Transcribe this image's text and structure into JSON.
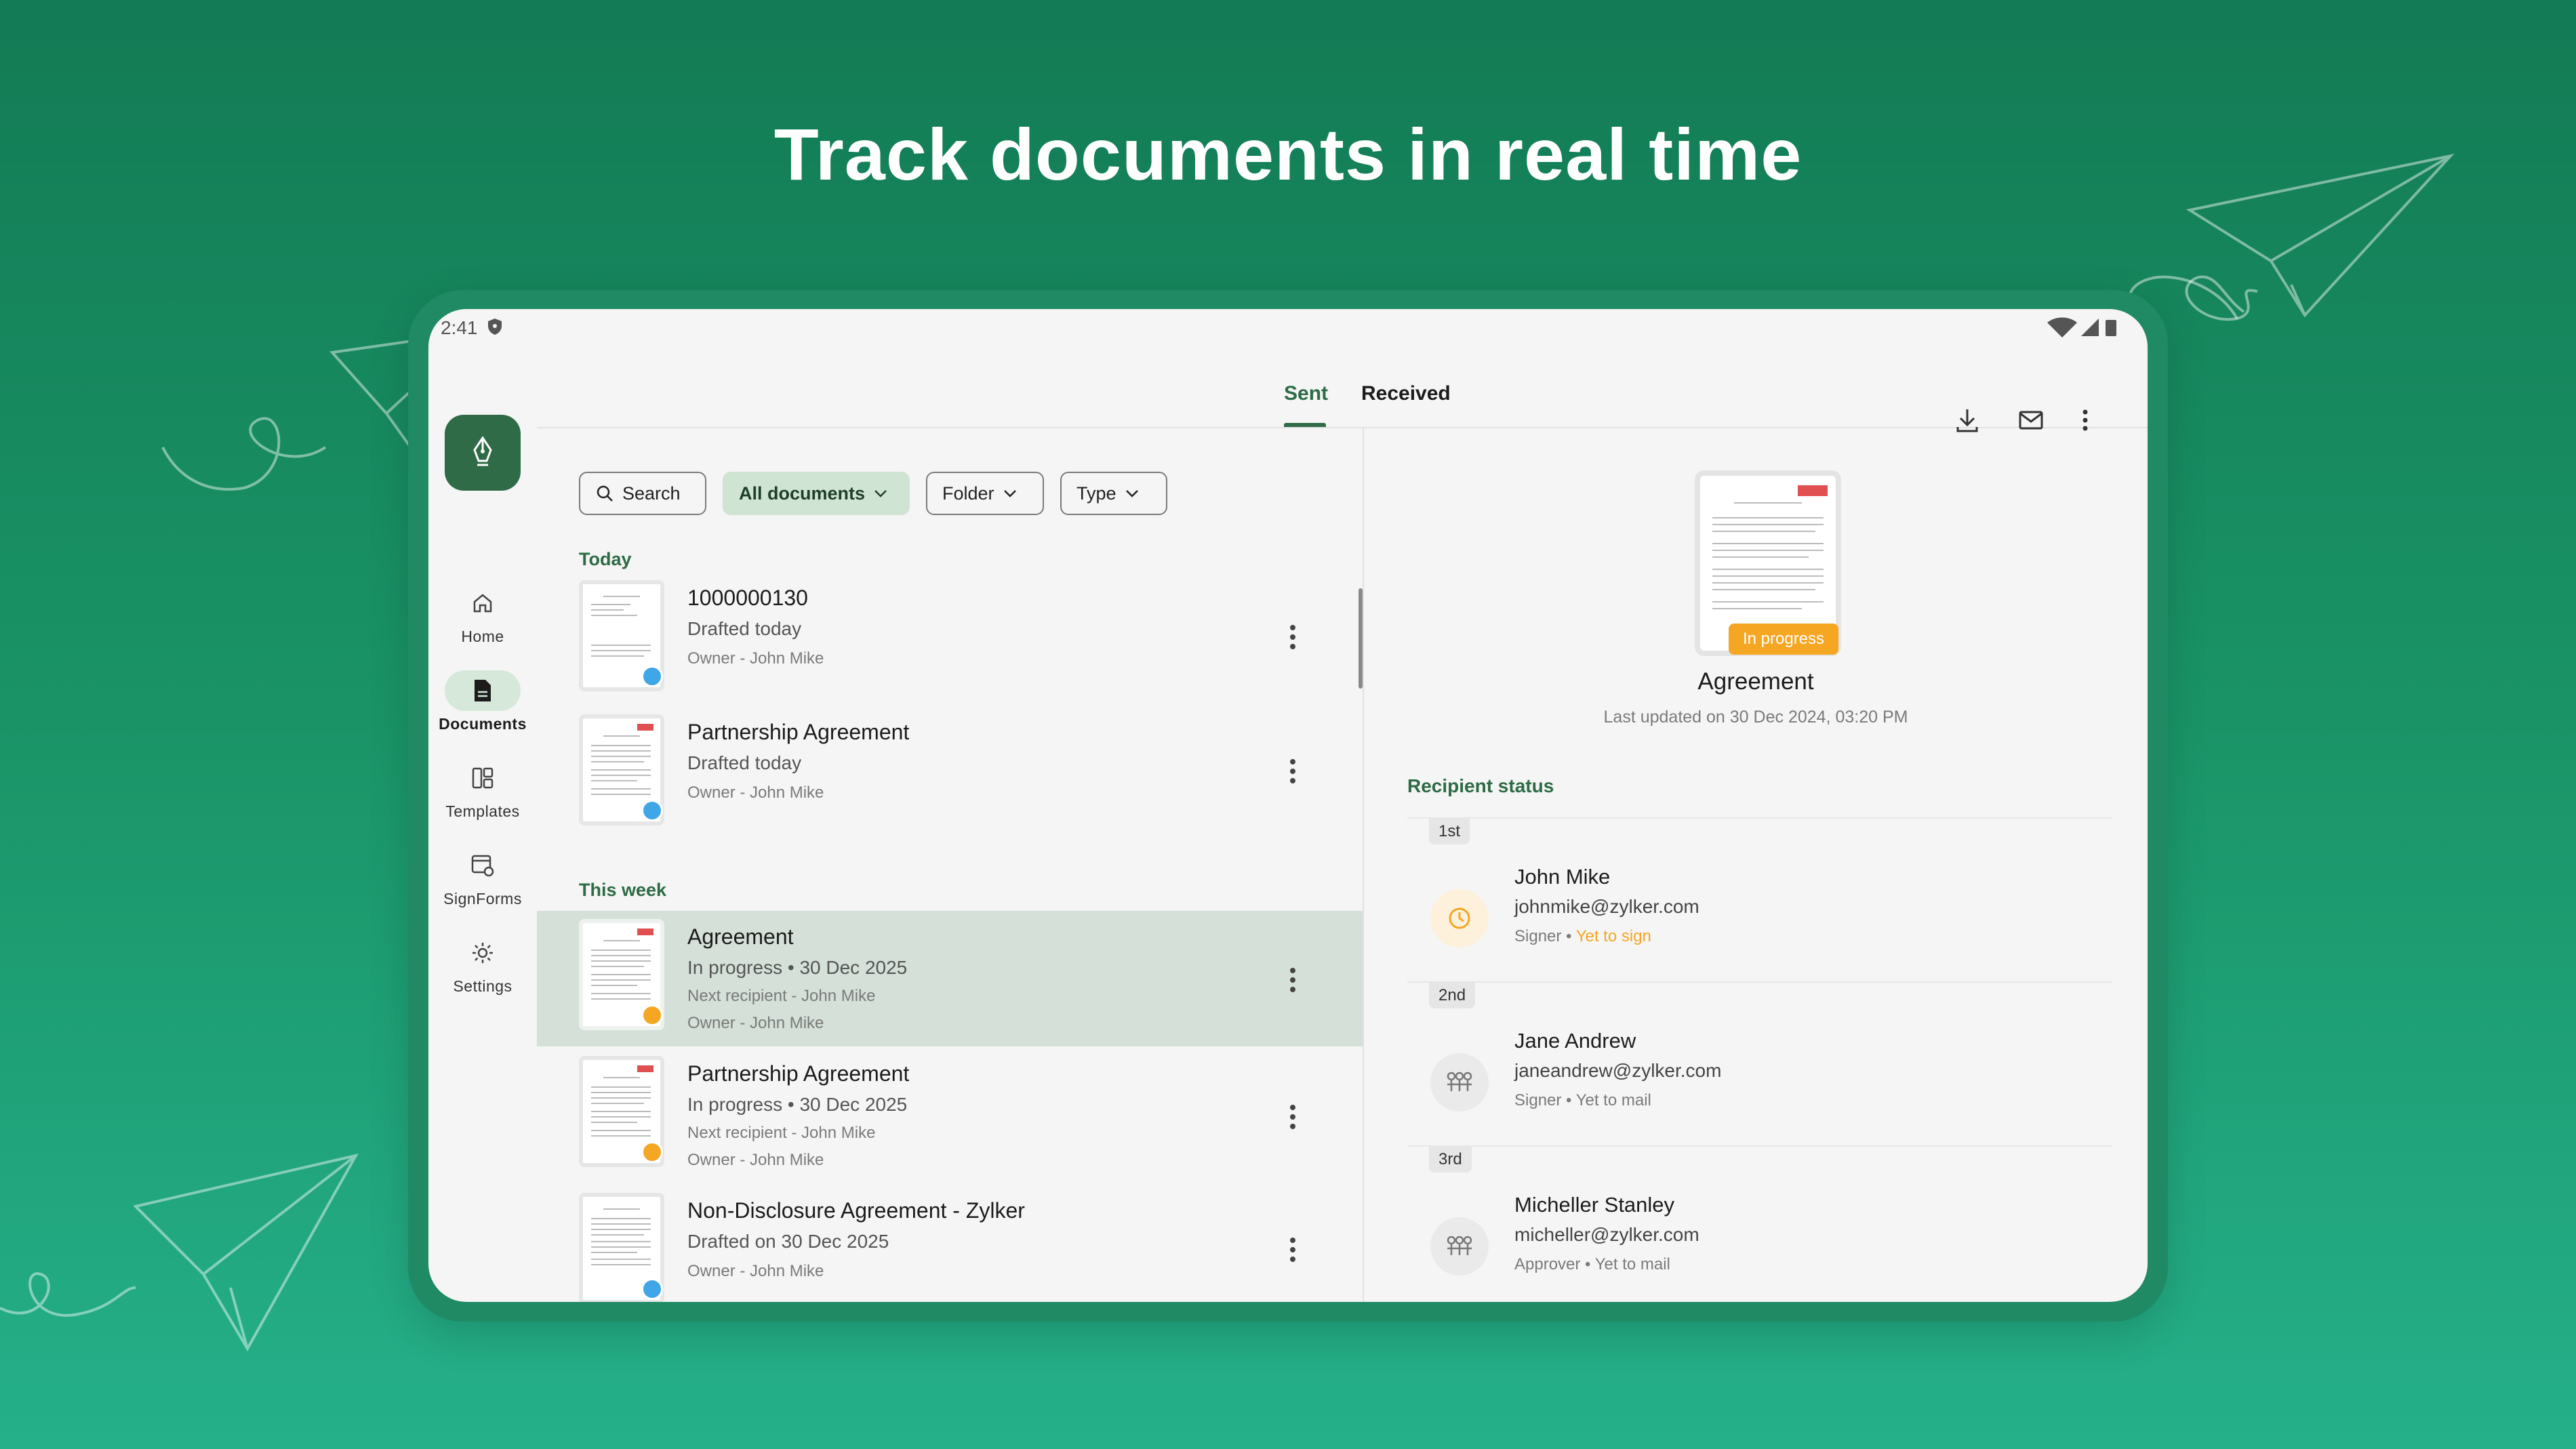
{
  "headline": "Track documents in real time",
  "status_bar": {
    "time": "2:41"
  },
  "nav": {
    "items": [
      {
        "label": "Home"
      },
      {
        "label": "Documents"
      },
      {
        "label": "Templates"
      },
      {
        "label": "SignForms"
      },
      {
        "label": "Settings"
      }
    ],
    "active": "Documents"
  },
  "tabs": {
    "sent": "Sent",
    "received": "Received",
    "active": "Sent"
  },
  "filters": {
    "search": "Search",
    "all_documents": "All documents",
    "folder": "Folder",
    "type": "Type"
  },
  "sections": {
    "today": "Today",
    "this_week": "This week"
  },
  "documents": [
    {
      "title": "1000000130",
      "status": "Drafted today",
      "owner": "Owner - John Mike",
      "badge_color": "#3fa6e8"
    },
    {
      "title": "Partnership Agreement",
      "status": "Drafted today",
      "owner": "Owner - John Mike",
      "badge_color": "#3fa6e8"
    },
    {
      "title": "Agreement",
      "status": "In progress",
      "date": "30 Dec 2025",
      "next_recipient": "Next recipient - John Mike",
      "owner": "Owner - John Mike",
      "badge_color": "#f5a623",
      "selected": true
    },
    {
      "title": "Partnership Agreement",
      "status": "In progress",
      "date": "30 Dec 2025",
      "next_recipient": "Next recipient - John Mike",
      "owner": "Owner - John Mike",
      "badge_color": "#f5a623"
    },
    {
      "title": "Non-Disclosure Agreement - Zylker",
      "status": "Drafted on 30 Dec 2025",
      "owner": "Owner - John Mike",
      "badge_color": "#3fa6e8"
    }
  ],
  "detail": {
    "status_badge": "In progress",
    "title": "Agreement",
    "last_updated": "Last updated on 30 Dec 2024, 03:20 PM",
    "recipient_status_heading": "Recipient status",
    "recipients": [
      {
        "order": "1st",
        "name": "John Mike",
        "email": "johnmike@zylker.com",
        "role": "Signer",
        "status": "Yet to sign",
        "status_color": "#f5a623",
        "icon": "clock-icon"
      },
      {
        "order": "2nd",
        "name": "Jane Andrew",
        "email": "janeandrew@zylker.com",
        "role": "Signer",
        "status": "Yet to mail",
        "icon": "signer-group-icon"
      },
      {
        "order": "3rd",
        "name": "Micheller Stanley",
        "email": "micheller@zylker.com",
        "role": "Approver",
        "status": "Yet to mail",
        "icon": "signer-group-icon"
      }
    ]
  },
  "colors": {
    "brand_green": "#2e6b46",
    "in_progress": "#f5a623",
    "draft": "#3fa6e8",
    "background_top": "#137b55",
    "background_bottom": "#25b08a"
  }
}
